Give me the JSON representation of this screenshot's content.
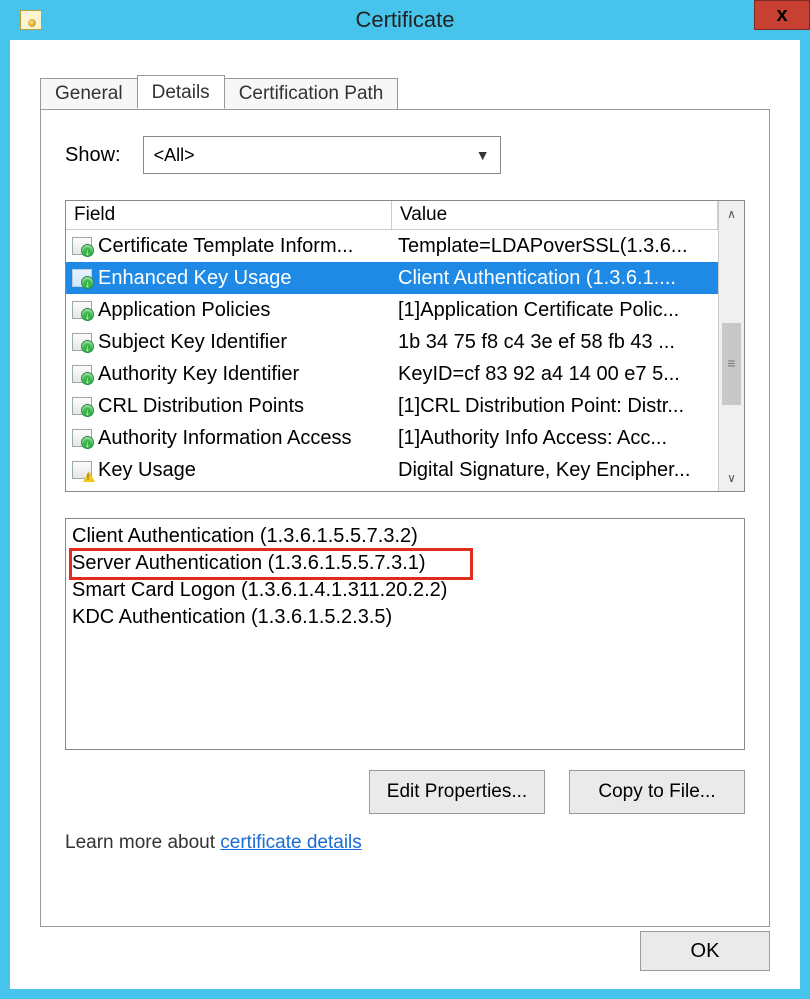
{
  "window": {
    "title": "Certificate",
    "close": "x"
  },
  "tabs": {
    "general": "General",
    "details": "Details",
    "certpath": "Certification Path"
  },
  "show": {
    "label": "Show:",
    "value": "<All>"
  },
  "columns": {
    "field": "Field",
    "value": "Value"
  },
  "rows": [
    {
      "icon": "ext",
      "field": "Certificate Template Inform...",
      "value": "Template=LDAPoverSSL(1.3.6..."
    },
    {
      "icon": "ext",
      "field": "Enhanced Key Usage",
      "value": "Client Authentication (1.3.6.1....",
      "selected": true
    },
    {
      "icon": "ext",
      "field": "Application Policies",
      "value": "[1]Application Certificate Polic..."
    },
    {
      "icon": "ext",
      "field": "Subject Key Identifier",
      "value": "1b 34 75 f8 c4 3e ef 58 fb 43 ..."
    },
    {
      "icon": "ext",
      "field": "Authority Key Identifier",
      "value": "KeyID=cf 83 92 a4 14 00 e7 5..."
    },
    {
      "icon": "ext",
      "field": "CRL Distribution Points",
      "value": "[1]CRL Distribution Point: Distr..."
    },
    {
      "icon": "ext",
      "field": "Authority Information Access",
      "value": "[1]Authority Info Access: Acc..."
    },
    {
      "icon": "warn",
      "field": "Key Usage",
      "value": "Digital Signature, Key Encipher..."
    }
  ],
  "detail_lines": [
    "Client Authentication (1.3.6.1.5.5.7.3.2)",
    "Server Authentication (1.3.6.1.5.5.7.3.1)",
    "Smart Card Logon (1.3.6.1.4.1.311.20.2.2)",
    "KDC Authentication (1.3.6.1.5.2.3.5)"
  ],
  "buttons": {
    "edit": "Edit Properties...",
    "copy": "Copy to File...",
    "ok": "OK"
  },
  "learn": {
    "prefix": "Learn more about ",
    "link": "certificate details"
  },
  "scroll": {
    "up": "∧",
    "down": "∨"
  }
}
